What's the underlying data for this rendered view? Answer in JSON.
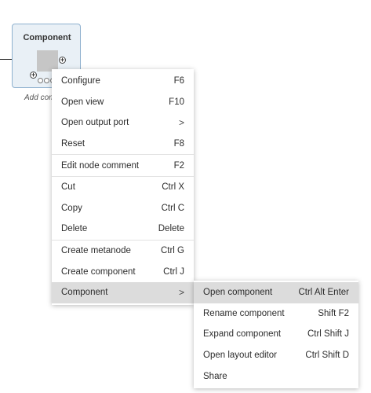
{
  "node": {
    "title": "Component",
    "comment": "Add comm"
  },
  "context_menu": {
    "groups": [
      [
        {
          "label": "Configure",
          "shortcut": "F6"
        },
        {
          "label": "Open view",
          "shortcut": "F10"
        },
        {
          "label": "Open output port",
          "shortcut": "",
          "submenu": true,
          "chevron": ">"
        },
        {
          "label": "Reset",
          "shortcut": "F8"
        }
      ],
      [
        {
          "label": "Edit node comment",
          "shortcut": "F2"
        }
      ],
      [
        {
          "label": "Cut",
          "shortcut": "Ctrl X"
        },
        {
          "label": "Copy",
          "shortcut": "Ctrl C"
        },
        {
          "label": "Delete",
          "shortcut": "Delete"
        }
      ],
      [
        {
          "label": "Create metanode",
          "shortcut": "Ctrl G"
        },
        {
          "label": "Create component",
          "shortcut": "Ctrl J"
        },
        {
          "label": "Component",
          "shortcut": "",
          "submenu": true,
          "chevron": ">",
          "active": true
        }
      ]
    ]
  },
  "submenu": {
    "items": [
      {
        "label": "Open component",
        "shortcut": "Ctrl Alt Enter",
        "active": true
      },
      {
        "label": "Rename component",
        "shortcut": "Shift F2"
      },
      {
        "label": "Expand component",
        "shortcut": "Ctrl Shift J"
      },
      {
        "label": "Open layout editor",
        "shortcut": "Ctrl Shift D"
      },
      {
        "label": "Share",
        "shortcut": ""
      }
    ]
  },
  "colors": {
    "node_fill": "#e9f0f6",
    "node_border": "#8fb1cf",
    "highlight": "#dcdcdc"
  }
}
